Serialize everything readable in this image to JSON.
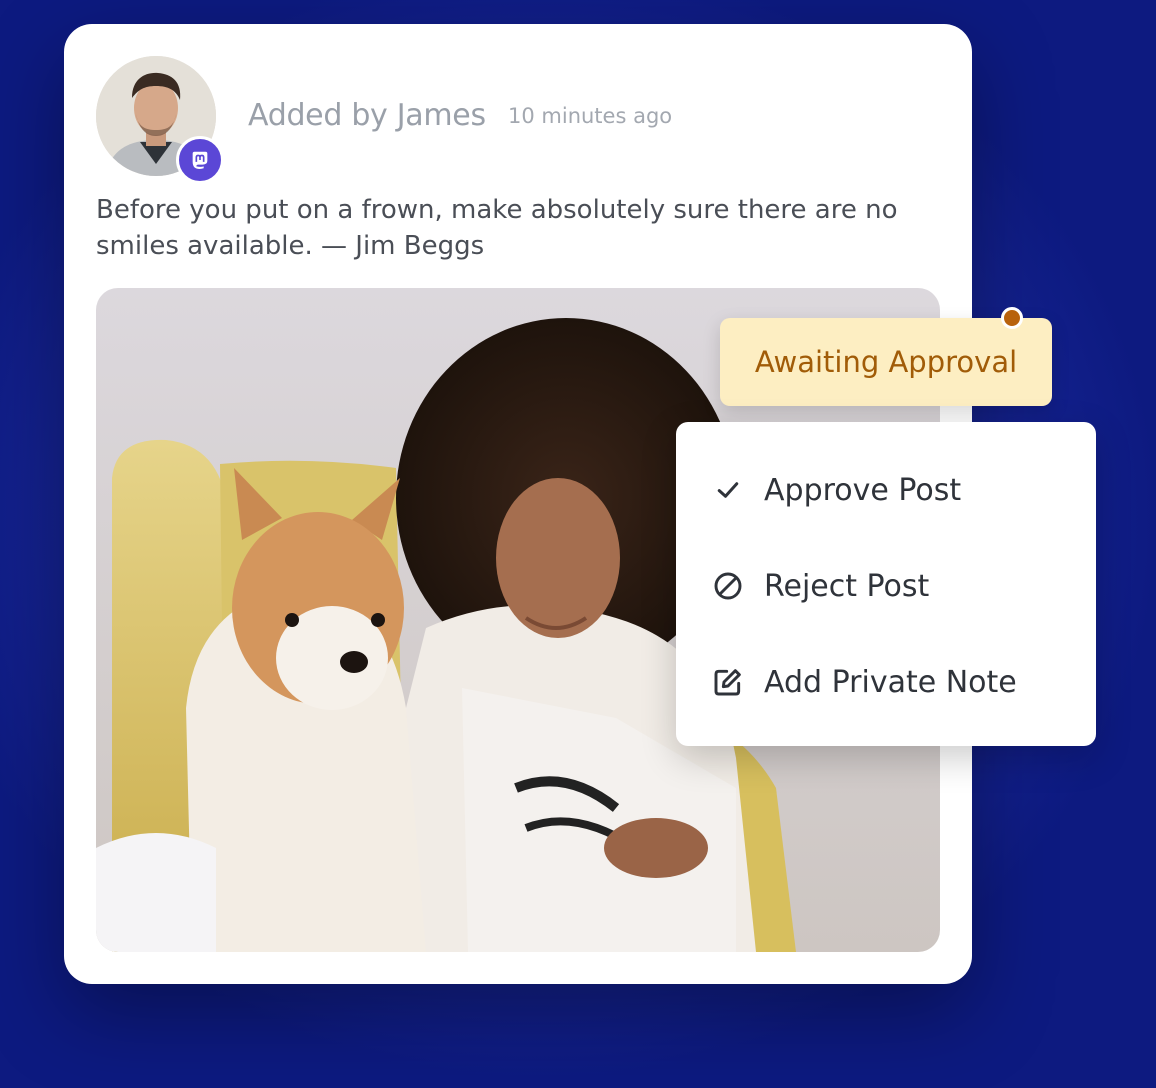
{
  "post": {
    "author": "Added by James",
    "time": "10 minutes ago",
    "text": "Before you put on a frown, make absolutely sure there are no smiles available. — Jim Beggs",
    "network_icon": "mastodon-icon"
  },
  "status": {
    "label": "Awaiting Approval",
    "color": "#a15c08",
    "background": "#fdeec2"
  },
  "menu": {
    "items": [
      {
        "label": "Approve Post",
        "icon": "check-icon"
      },
      {
        "label": "Reject Post",
        "icon": "block-icon"
      },
      {
        "label": "Add Private Note",
        "icon": "edit-note-icon"
      }
    ]
  },
  "colors": {
    "brand_mastodon": "#5b47d6",
    "status_dot": "#b8620c"
  }
}
